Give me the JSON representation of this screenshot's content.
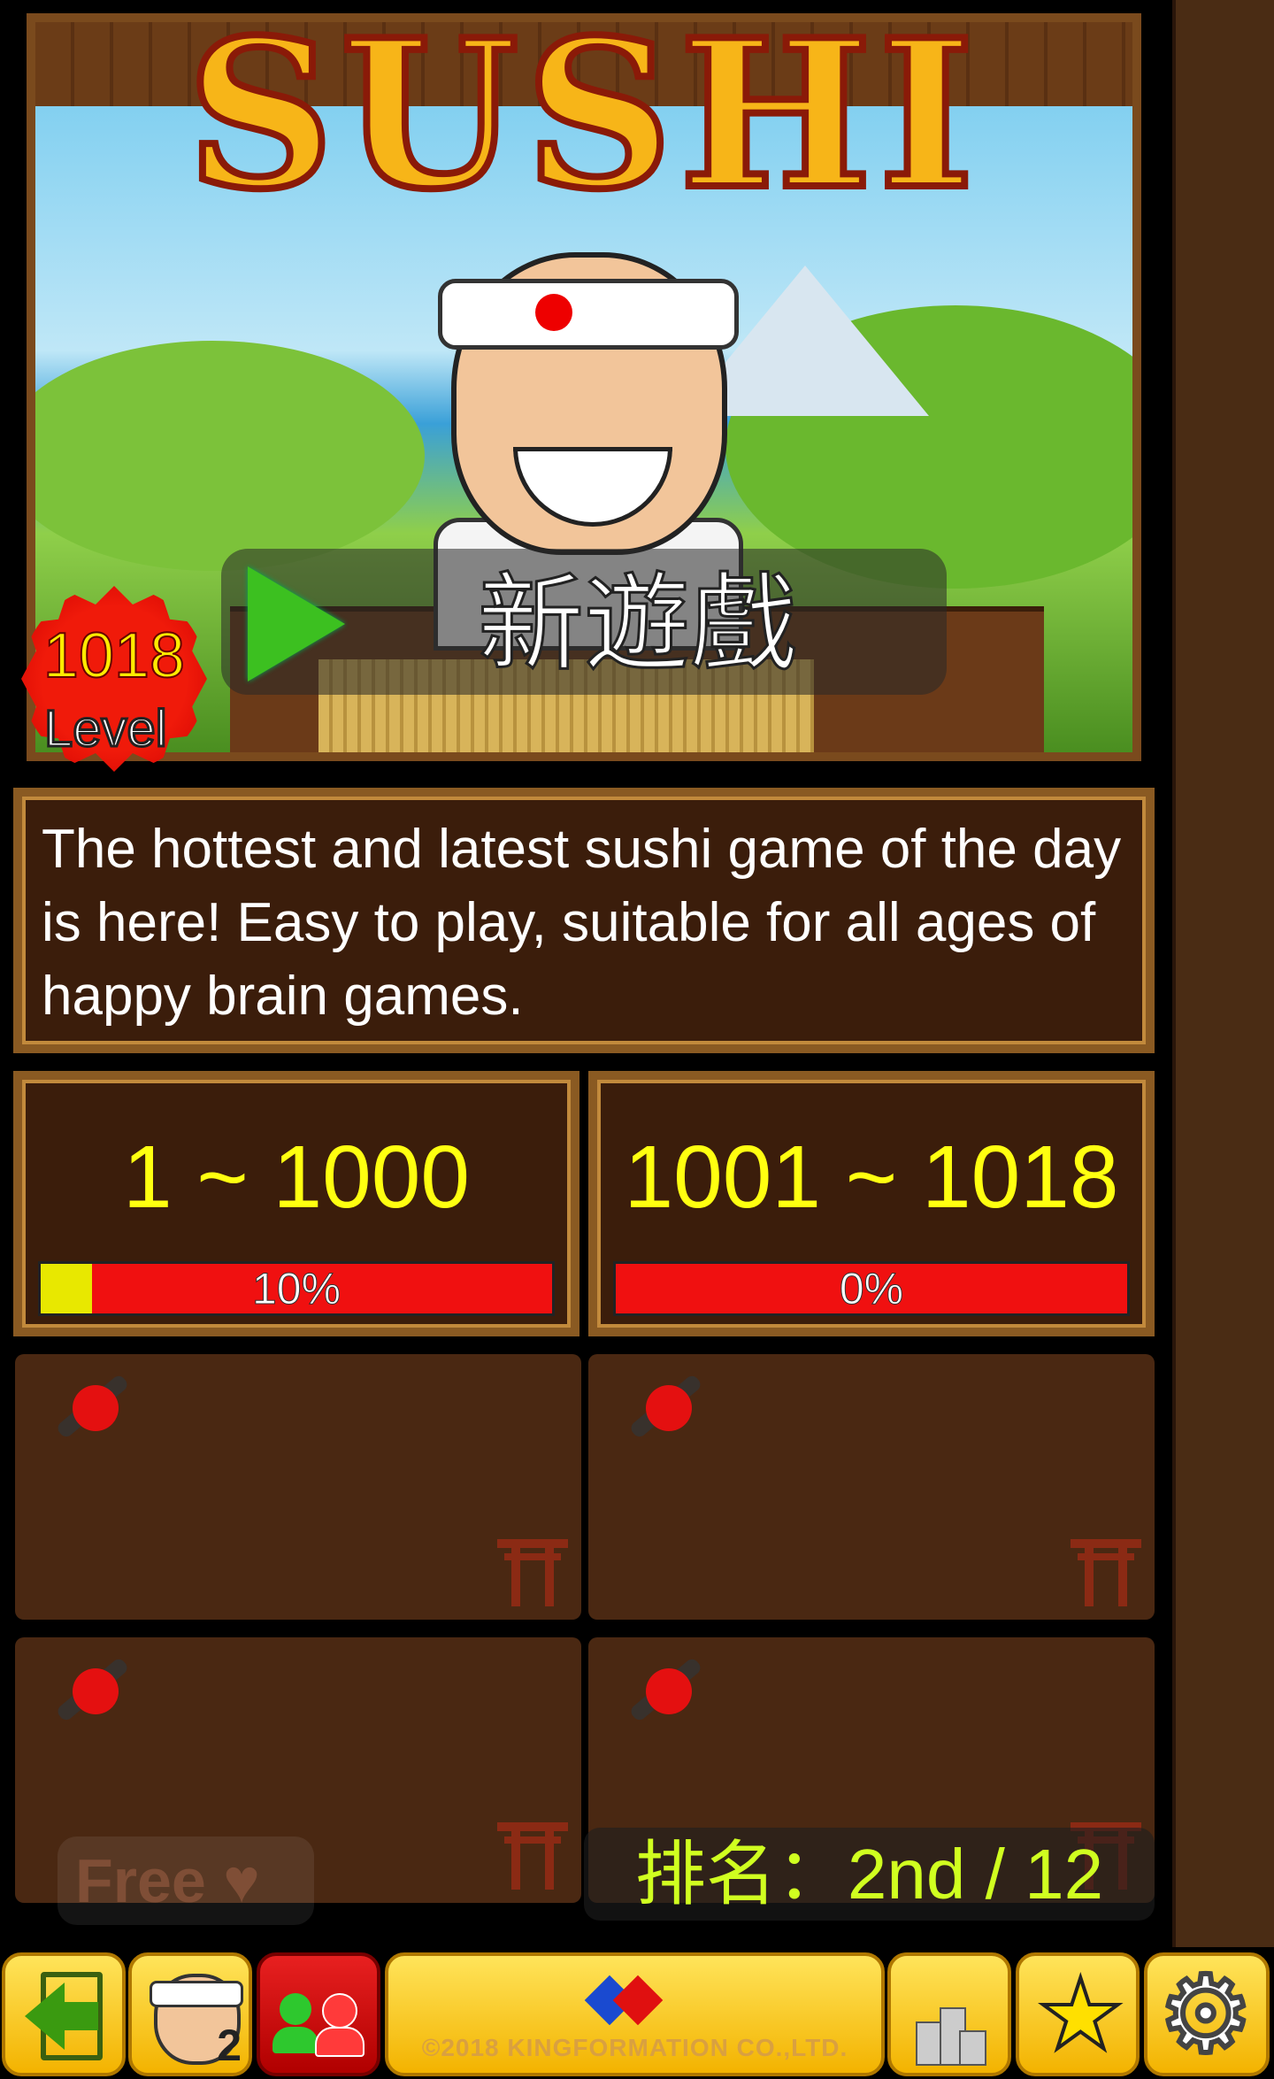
{
  "banner": {
    "title": "SUSHI",
    "play_label": "新遊戲",
    "level_number": "1018",
    "level_label": "Level"
  },
  "description": "The hottest and latest sushi game of the day is here! Easy to play, suitable for all ages of happy brain games.",
  "ranges": [
    {
      "label": "1 ~ 1000",
      "progress": 0.1,
      "percent_text": "10%"
    },
    {
      "label": "1001 ~ 1018",
      "progress": 0.0,
      "percent_text": "0%"
    }
  ],
  "free_label": "Free ♥",
  "ranking_text": "排名：2nd / 12",
  "toolbar": {
    "avatar_count": "2",
    "copyright": "©2018 KINGFORMATION CO.,LTD."
  },
  "icons": [
    "back-icon",
    "chef-avatar-icon",
    "switch-players-icon",
    "company-logo-icon",
    "podium-icon",
    "star-icon",
    "gear-icon",
    "japan-map-icon",
    "torii-icon"
  ],
  "colors": {
    "accent_yellow": "#ffff10",
    "progress_red": "#f01010",
    "progress_fill": "#e8e800",
    "wood": "#8a5a22",
    "panel": "#3b1d0b"
  }
}
